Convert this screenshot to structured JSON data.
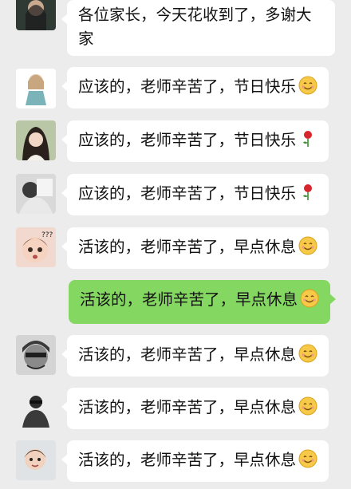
{
  "chat": {
    "messages": [
      {
        "text": "各位家长，今天花收到了，多谢大",
        "text2": "家",
        "emoji": ""
      },
      {
        "text": "应该的，老师辛苦了，节日快乐",
        "emoji": "smile-emoji-icon"
      },
      {
        "text": "应该的，老师辛苦了，节日快乐",
        "emoji": "rose-emoji-icon"
      },
      {
        "text": "应该的，老师辛苦了，节日快乐",
        "emoji": "rose-emoji-icon"
      },
      {
        "text": "活该的，老师辛苦了，早点休息",
        "emoji": "smile-emoji-icon"
      },
      {
        "text": "活该的，老师辛苦了，早点休息",
        "emoji": "smile-emoji-icon"
      },
      {
        "text": "活该的，老师辛苦了，早点休息",
        "emoji": "smile-emoji-icon"
      },
      {
        "text": "活该的，老师辛苦了，早点休息",
        "emoji": "smile-emoji-icon"
      },
      {
        "text": "活该的，老师辛苦了，早点休息",
        "emoji": "smile-emoji-icon"
      }
    ]
  },
  "avatar_badge": "???",
  "colors": {
    "bubble": "#ffffff",
    "self_bubble": "#84d862",
    "background": "#ececec"
  }
}
